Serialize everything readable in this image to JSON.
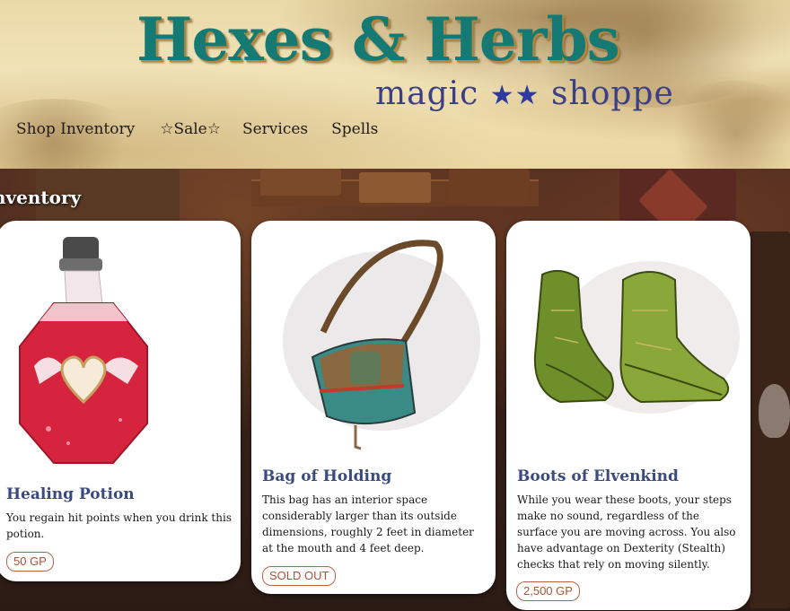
{
  "header": {
    "title": "Hexes & Herbs",
    "subtitle_left": "magic",
    "subtitle_stars": "★★",
    "subtitle_right": "shoppe"
  },
  "nav": {
    "items": [
      {
        "label": "Shop Inventory"
      },
      {
        "label": "☆Sale☆"
      },
      {
        "label": "Services"
      },
      {
        "label": "Spells"
      }
    ]
  },
  "main": {
    "section_title": "nventory"
  },
  "cards": [
    {
      "name": "Healing Potion",
      "description": "You regain hit points when you drink this potion.",
      "price": "50 GP",
      "icon": "healing-potion-icon"
    },
    {
      "name": "Bag of Holding",
      "description": "This bag has an interior space considerably larger than its outside dimensions, roughly 2 feet in diameter at the mouth and 4 feet deep.",
      "price": "SOLD OUT",
      "icon": "bag-icon"
    },
    {
      "name": "Boots of Elvenkind",
      "description": "While you wear these boots, your steps make no sound, regardless of the surface you are moving across. You also have advantage on Dexterity (Stealth) checks that rely on moving silently.",
      "price": "2,500 GP",
      "icon": "boots-icon"
    }
  ],
  "colors": {
    "title": "#157a73",
    "subtitle": "#3b3f86",
    "card_name": "#3a4a7e",
    "price": "#a5553a"
  }
}
